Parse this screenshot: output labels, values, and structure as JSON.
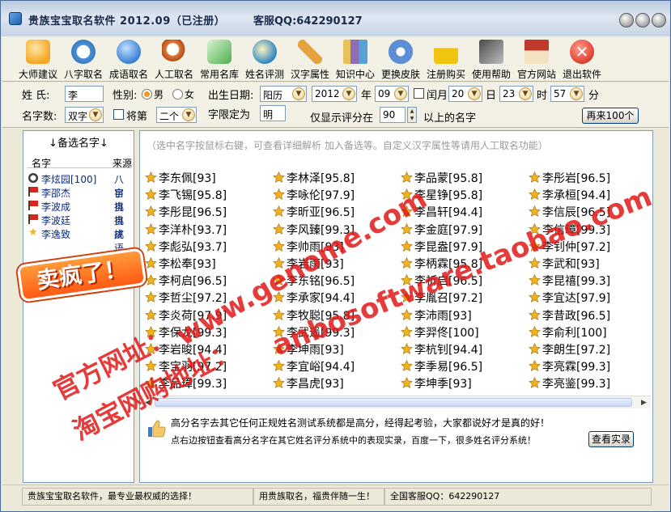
{
  "window": {
    "title": "贵族宝宝取名软件  2012.09（已注册）",
    "qq": "客服QQ:642290127"
  },
  "toolbar": [
    {
      "label": "大师建议",
      "icon": "master-advice-icon",
      "color": "#f5a623"
    },
    {
      "label": "八字取名",
      "icon": "clock-icon",
      "color": "#4a90d9"
    },
    {
      "label": "成语取名",
      "icon": "download-arrow-icon",
      "color": "#3b7fd4"
    },
    {
      "label": "人工取名",
      "icon": "magnifier-icon",
      "color": "#e07b39"
    },
    {
      "label": "常用名库",
      "icon": "edit-pen-icon",
      "color": "#4caf50"
    },
    {
      "label": "姓名评测",
      "icon": "evaluate-icon",
      "color": "#2e86c1"
    },
    {
      "label": "汉字属性",
      "icon": "pencil-icon",
      "color": "#e6a23c"
    },
    {
      "label": "知识中心",
      "icon": "books-icon",
      "color": "#8e6fb5"
    },
    {
      "label": "更换皮肤",
      "icon": "gear-icon",
      "color": "#5d8fd6"
    },
    {
      "label": "注册购买",
      "icon": "lock-icon",
      "color": "#f1c40f"
    },
    {
      "label": "使用帮助",
      "icon": "help-icon",
      "color": "#7f8c8d"
    },
    {
      "label": "官方网站",
      "icon": "home-icon",
      "color": "#c0392b"
    },
    {
      "label": "退出软件",
      "icon": "exit-icon",
      "color": "#e74c3c"
    }
  ],
  "form": {
    "surname_label": "姓  氏:",
    "surname_value": "李",
    "gender_label": "性别:",
    "male_label": "男",
    "female_label": "女",
    "birth_label": "出生日期:",
    "calendar_value": "阳历",
    "year_value": "2012",
    "year_label": "年",
    "month_value": "09",
    "leap_label": "闰月",
    "day_value": "20",
    "day_label": "日",
    "hour_value": "23",
    "hour_label": "时",
    "minute_value": "57",
    "minute_label": "分",
    "count_label": "名字数:",
    "count_value": "双字",
    "jiangdi_label": "将第",
    "position_value": "二个",
    "fixed_label": "字限定为",
    "fixed_value": "明",
    "score_prefix": "仅显示评分在",
    "score_value": "90",
    "score_suffix": "以上的名字",
    "more_button": "再来100个"
  },
  "candidates": {
    "title": "↓备选名字↓",
    "col_name": "名字",
    "col_source": "来源",
    "rows": [
      {
        "name": "李炫园[100]",
        "source": "八字",
        "icon": "clock-icon"
      },
      {
        "name": "李邵杰",
        "source": "自挑",
        "icon": "red-flag-icon"
      },
      {
        "name": "李波成",
        "source": "自挑",
        "icon": "red-flag-icon"
      },
      {
        "name": "李波廷",
        "source": "自挑",
        "icon": "red-flag-icon"
      },
      {
        "name": "李逸致",
        "source": "成语",
        "icon": "star-icon"
      }
    ]
  },
  "hint": "（选中名字按鼠标右键，可查看详细解析 加入备选等。自定义汉字属性等请用人工取名功能）",
  "names": [
    [
      "李东佩[93]",
      "李林泽[95.8]",
      "李品蒙[95.8]",
      "李彤岩[96.5]"
    ],
    [
      "李飞锡[95.8]",
      "李咏伦[97.9]",
      "李星铮[95.8]",
      "李承桓[94.4]"
    ],
    [
      "李彤昆[96.5]",
      "李昕亚[96.5]",
      "李昌轩[94.4]",
      "李信辰[96.5]"
    ],
    [
      "李洋朴[93.7]",
      "李风臻[99.3]",
      "李金庭[97.9]",
      "李信璋[99.3]"
    ],
    [
      "李彪弘[93.7]",
      "李帅雨[93]",
      "李昆盎[97.9]",
      "李钊仲[97.2]"
    ],
    [
      "李松奉[93]",
      "李岩雨[93]",
      "李柄霖[95.8]",
      "李武和[93]"
    ],
    [
      "李柯启[96.5]",
      "李东铭[96.5]",
      "李祈启[96.5]",
      "李昆禧[99.3]"
    ],
    [
      "李哲尘[97.2]",
      "李承家[94.4]",
      "李胤召[97.2]",
      "李宜达[97.9]"
    ],
    [
      "李炎荷[97.9]",
      "李牧聪[95.8]",
      "李沛雨[93]",
      "李昔政[96.5]"
    ],
    [
      "李保龙[99.3]",
      "李武遥[99.3]",
      "李羿佟[100]",
      "李俞利[100]"
    ],
    [
      "李岩晙[94.4]",
      "李坤雨[93]",
      "李杭钊[94.4]",
      "李朗生[97.2]"
    ],
    [
      "李宝羽[97.2]",
      "李宜峪[94.4]",
      "李季易[96.5]",
      "李亮霖[99.3]"
    ],
    [
      "李品璋[99.3]",
      "李昌虎[93]",
      "李坤季[93]",
      "李亮鉴[99.3]"
    ]
  ],
  "note": {
    "line1": "高分名字去其它任何正规姓名测试系统都是高分，经得起考验，大家都说好才是真的好！",
    "line2": "点右边按钮查看高分名字在其它姓名评分系统中的表现实录，百度一下，很多姓名评分系统！",
    "button": "查看实录"
  },
  "status": {
    "left": "贵族宝宝取名软件，最专业最权威的选择！",
    "mid": "用贵族取名，福贵伴随一生！",
    "right": "全国客服QQ：642290127"
  },
  "watermarks": {
    "sticker": "卖疯了！",
    "url1": "www.genome.com",
    "url2": "anbosoftware.taobao.com",
    "official": "官方网址：",
    "taobao": "淘宝网购地址："
  },
  "colors": {
    "accent": "#0a2a80",
    "watermark": "#e11919",
    "sticker_bg": "#ff6a1a",
    "star": "#f2b21b"
  }
}
